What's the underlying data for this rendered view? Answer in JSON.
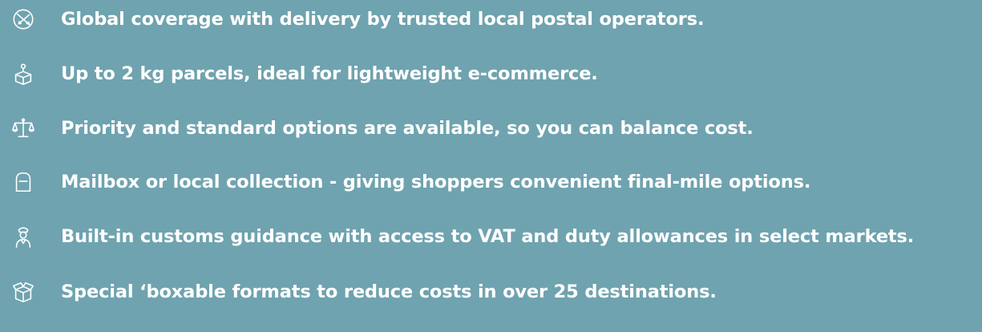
{
  "features": [
    {
      "icon": "globe-arrows-icon",
      "text": "Global coverage with delivery by trusted local postal operators."
    },
    {
      "icon": "parcel-weight-icon",
      "text": "Up to 2 kg parcels, ideal for lightweight e-commerce."
    },
    {
      "icon": "balance-scale-icon",
      "text": "Priority and standard options are available, so you can balance cost."
    },
    {
      "icon": "mailbox-icon",
      "text": "Mailbox or local collection - giving shoppers convenient final-mile options."
    },
    {
      "icon": "customs-officer-icon",
      "text": "Built-in customs guidance with access to VAT and duty allowances in select markets."
    },
    {
      "icon": "open-box-icon",
      "text": "Special ‘boxable formats to reduce costs in over 25 destinations."
    }
  ],
  "colors": {
    "background": "#6fa3af",
    "text": "#ffffff"
  }
}
